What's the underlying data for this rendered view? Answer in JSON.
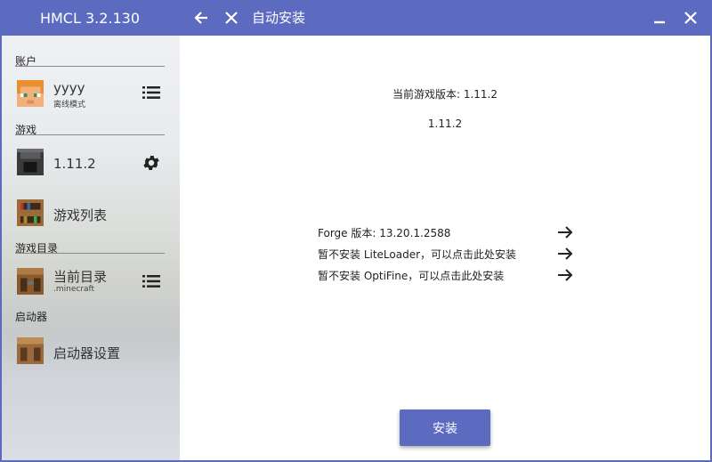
{
  "app": {
    "title": "HMCL 3.2.130"
  },
  "header": {
    "title": "自动安装",
    "back_icon": "arrow-left-icon",
    "close_page_icon": "close-icon",
    "minimize_icon": "minimize-icon",
    "close_window_icon": "close-icon"
  },
  "sidebar": {
    "sections": {
      "account": "账户",
      "game": "游戏",
      "game_dir": "游戏目录",
      "launcher": "启动器"
    },
    "account_item": {
      "name": "yyyy",
      "sub": "离线模式"
    },
    "version_item": {
      "name": "1.11.2"
    },
    "game_list_item": {
      "name": "游戏列表"
    },
    "dir_item": {
      "name": "当前目录",
      "sub": ".minecraft"
    },
    "launcher_settings_item": {
      "name": "启动器设置"
    }
  },
  "main": {
    "current_version_label": "当前游戏版本: 1.11.2",
    "version_name": "1.11.2",
    "options": [
      {
        "label": "Forge 版本: 13.20.1.2588"
      },
      {
        "label": "暂不安装 LiteLoader，可以点击此处安装"
      },
      {
        "label": "暂不安装 OptiFine，可以点击此处安装"
      }
    ],
    "install_label": "安装"
  },
  "colors": {
    "accent": "#5c6bc0",
    "background": "#ffffff"
  }
}
